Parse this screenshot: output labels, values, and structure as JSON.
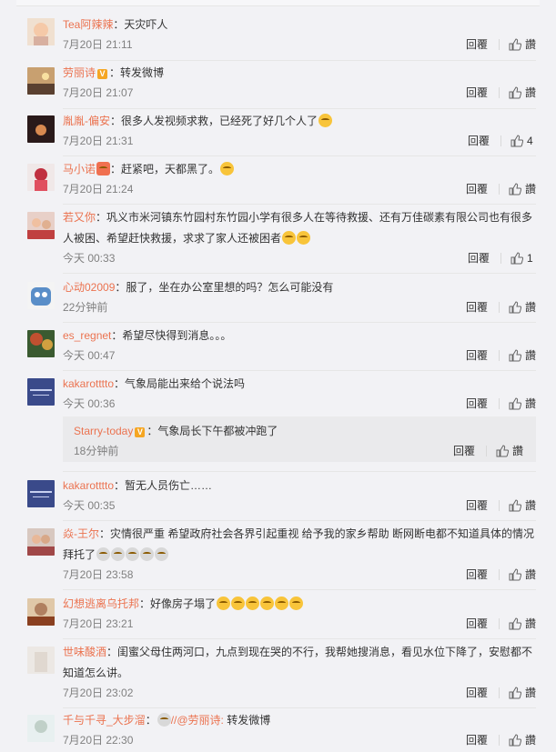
{
  "actions": {
    "reply_label": "回覆",
    "like_label": "讚"
  },
  "comments": [
    {
      "name": "Tea阿辣辣",
      "text": "：天灾吓人",
      "time": "7月20日 21:11",
      "likes": "讚"
    },
    {
      "name": "劳丽诗",
      "verified": true,
      "text": "：转发微博",
      "time": "7月20日 21:07",
      "likes": "讚"
    },
    {
      "name": "胤胤-偏安",
      "text": "：很多人发视频求救，已经死了好几个人了",
      "time": "7月20日 21:31",
      "likes": "4"
    },
    {
      "name": "马小诺",
      "text": "：赶紧吧，天都黑了。",
      "time": "7月20日 21:24",
      "likes": "讚"
    },
    {
      "name": "若又你",
      "text": "：巩义市米河镇东竹园村东竹园小学有很多人在等待救援、还有万佳碳素有限公司也有很多人被困、希望赶快救援，求求了家人还被困者",
      "time": "今天 00:33",
      "likes": "1"
    },
    {
      "name": "心动02009",
      "text": "：服了，坐在办公室里想的吗？怎么可能没有",
      "time": "22分钟前",
      "likes": "讚"
    },
    {
      "name": "es_regnet",
      "text": "：希望尽快得到消息。。。",
      "time": "今天 00:47",
      "likes": "讚"
    },
    {
      "name": "kakarotttto",
      "text": "：气象局能出来给个说法吗",
      "time": "今天 00:36",
      "likes": "讚"
    },
    {
      "name": "kakarotttto",
      "text": "：暂无人员伤亡……",
      "time": "今天 00:35",
      "likes": "讚"
    },
    {
      "name": "焱-王尔",
      "text": "：灾情很严重 希望政府社会各界引起重视 给予我的家乡帮助 断网断电都不知道具体的情况 拜托了",
      "time": "7月20日 23:58",
      "likes": "讚"
    },
    {
      "name": "幻想逃离乌托邦",
      "text": "：好像房子塌了",
      "time": "7月20日 23:21",
      "likes": "讚"
    },
    {
      "name": "世味酸酒",
      "text": "：闺蜜父母住两河口，九点到现在哭的不行，我帮她搜消息，看见水位下降了，安慰都不知道怎么讲。",
      "time": "7月20日 23:02",
      "likes": "讚"
    },
    {
      "name": "千与千寻_大步溜",
      "text": "：",
      "mention": "//@劳丽诗:",
      "text2": " 转发微博",
      "time": "7月20日 22:30",
      "likes": "讚"
    }
  ],
  "nested_reply": {
    "name": "Starry-today",
    "verified": true,
    "text": "：气象局长下午都被冲跑了",
    "time": "18分钟前",
    "likes": "讚"
  },
  "colors": {
    "name": "#eb7350",
    "time": "#808080",
    "background": "#f2f2f5",
    "verified": "#f5a623"
  }
}
